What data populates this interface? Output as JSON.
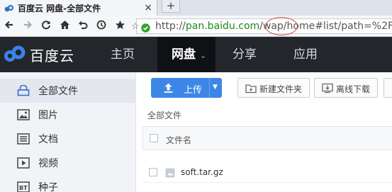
{
  "browser": {
    "tab_title": "百度云 网盘-全部文件",
    "tab_close": "×",
    "new_tab": "+",
    "url_scheme": "http://",
    "url_host": "pan.baidu.com",
    "url_slash": "/",
    "url_highlight": "wap",
    "url_rest": "/home#list/path=%2F"
  },
  "app": {
    "logo_text": "百度云",
    "nav": [
      {
        "label": "主页"
      },
      {
        "label": "网盘"
      },
      {
        "label": "分享"
      },
      {
        "label": "应用"
      }
    ]
  },
  "sidebar": {
    "items": [
      {
        "label": "全部文件",
        "icon": "folder-icon"
      },
      {
        "label": "图片",
        "icon": "image-icon"
      },
      {
        "label": "文档",
        "icon": "document-icon"
      },
      {
        "label": "视频",
        "icon": "video-icon"
      },
      {
        "label": "种子",
        "icon": "torrent-icon"
      }
    ]
  },
  "toolbar": {
    "upload_label": "上传",
    "new_folder_label": "新建文件夹",
    "offline_download_label": "离线下载"
  },
  "main": {
    "breadcrumb": "全部文件",
    "column_filename": "文件名",
    "files": [
      {
        "name": "soft.tar.gz"
      }
    ]
  },
  "colors": {
    "header_bg": "#23272c",
    "upload_blue": "#3c87e6",
    "url_host_green": "#1d8a1d",
    "annotation_red": "#d9433c"
  }
}
